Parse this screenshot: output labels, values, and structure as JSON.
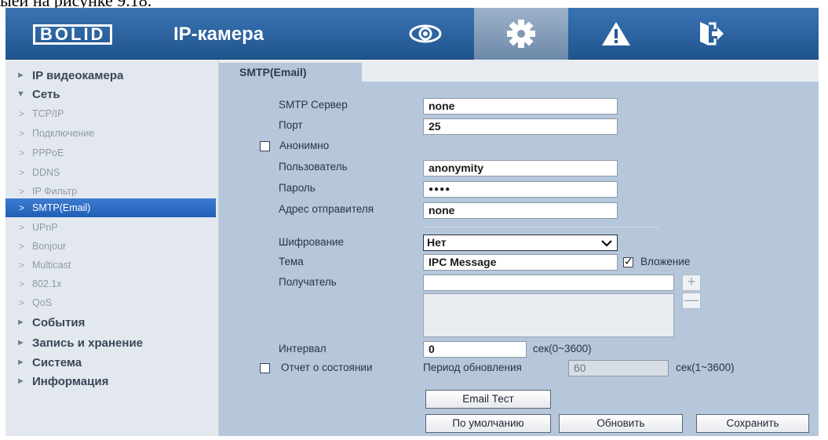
{
  "caption": "ыей на рисунке 9.18.",
  "header": {
    "logo_text": "BOLID",
    "app_title": "IP-камера",
    "nav": [
      {
        "icon": "eye-icon"
      },
      {
        "icon": "gear-icon",
        "active": true
      },
      {
        "icon": "warning-icon"
      },
      {
        "icon": "exit-icon"
      }
    ]
  },
  "sidebar": {
    "items": [
      {
        "label": "IP видеокамера",
        "level": "top",
        "marker": "►"
      },
      {
        "label": "Сеть",
        "level": "top",
        "marker": "▼"
      },
      {
        "label": "TCP/IP",
        "level": "sub"
      },
      {
        "label": "Подключение",
        "level": "sub"
      },
      {
        "label": "PPPoE",
        "level": "sub"
      },
      {
        "label": "DDNS",
        "level": "sub"
      },
      {
        "label": "IP Фильтр",
        "level": "sub"
      },
      {
        "label": "SMTP(Email)",
        "level": "sub",
        "selected": true
      },
      {
        "label": "UPnP",
        "level": "sub"
      },
      {
        "label": "Bonjour",
        "level": "sub"
      },
      {
        "label": "Multicast",
        "level": "sub"
      },
      {
        "label": "802.1x",
        "level": "sub"
      },
      {
        "label": "QoS",
        "level": "sub"
      },
      {
        "label": "События",
        "level": "top",
        "marker": "►"
      },
      {
        "label": "Запись и хранение",
        "level": "top",
        "marker": "►"
      },
      {
        "label": "Система",
        "level": "top",
        "marker": "►"
      },
      {
        "label": "Информация",
        "level": "top",
        "marker": "►"
      }
    ]
  },
  "tab": {
    "label": "SMTP(Email)"
  },
  "form": {
    "smtp_server_label": "SMTP Сервер",
    "smtp_server_value": "none",
    "port_label": "Порт",
    "port_value": "25",
    "anonymous_label": "Анонимно",
    "anonymous_checked": false,
    "user_label": "Пользователь",
    "user_value": "anonymity",
    "password_label": "Пароль",
    "password_value": "●●●●",
    "sender_label": "Адрес отправителя",
    "sender_value": "none",
    "encryption_label": "Шифрование",
    "encryption_value": "Нет",
    "subject_label": "Тема",
    "subject_value": "IPC Message",
    "attachment_label": "Вложение",
    "attachment_checked": true,
    "recipient_label": "Получатель",
    "recipient_value": "",
    "add_symbol": "+",
    "remove_symbol": "—",
    "interval_label": "Интервал",
    "interval_value": "0",
    "interval_unit": "сек(0~3600)",
    "status_report_label": "Отчет о состоянии",
    "status_report_checked": false,
    "update_period_label": "Период обновления",
    "update_period_value": "60",
    "update_period_unit": "сек(1~3600)"
  },
  "buttons": {
    "email_test": "Email Тест",
    "defaults": "По умолчанию",
    "refresh": "Обновить",
    "save": "Сохранить"
  }
}
